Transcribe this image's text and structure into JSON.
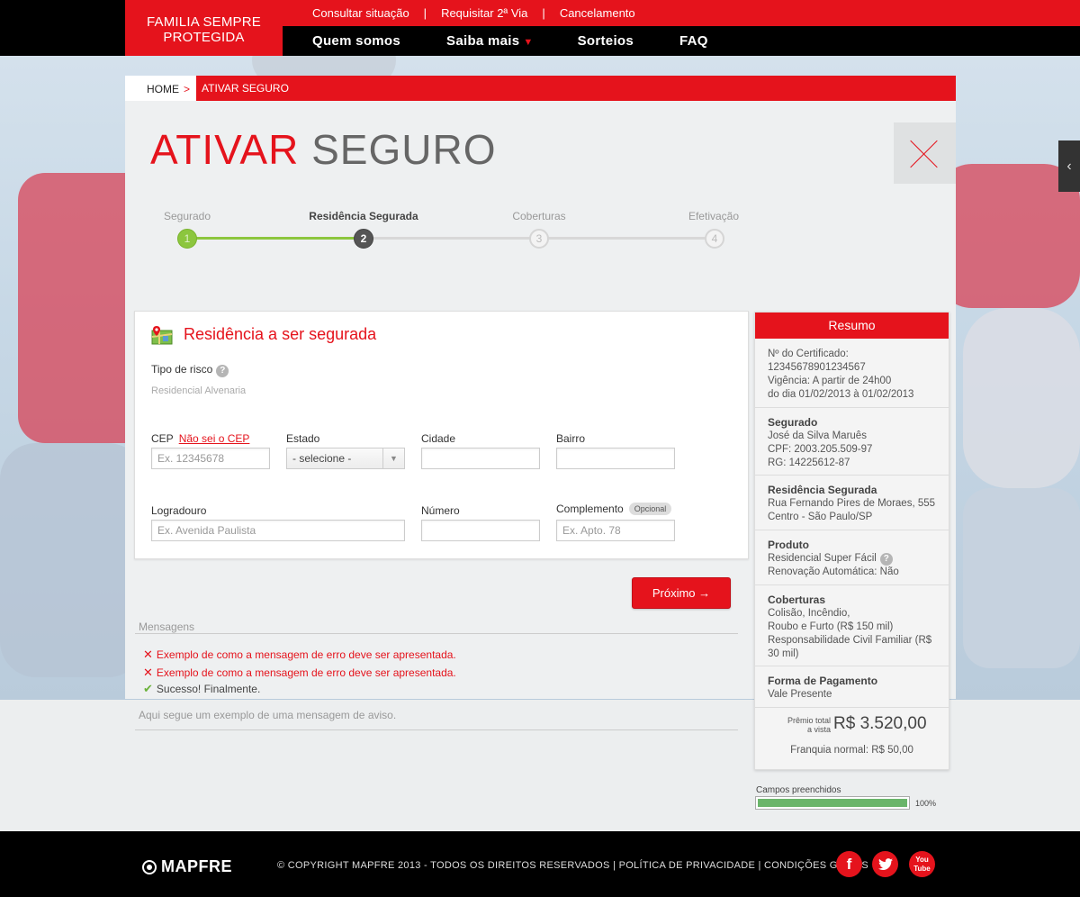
{
  "header": {
    "brand": "FAMILIA SEMPRE PROTEGIDA",
    "top_links": [
      "Consultar situação",
      "Requisitar 2ª Via",
      "Cancelamento"
    ],
    "separator": "|",
    "nav": [
      "Quem somos",
      "Saiba mais",
      "Sorteios",
      "FAQ"
    ],
    "nav_dropdown_icon": "chevron-down-icon"
  },
  "breadcrumb": {
    "home": "HOME",
    "arrow": ">",
    "current": "ATIVAR SEGURO"
  },
  "page_title": {
    "part1": "ATIVAR",
    "part2": "SEGURO"
  },
  "close_icon": "close-icon",
  "side_tab_icon": "chevron-left-icon",
  "side_tab_glyph": "‹",
  "stepper": {
    "steps": [
      {
        "label": "Segurado",
        "number": "1",
        "state": "done"
      },
      {
        "label": "Residência Segurada",
        "number": "2",
        "state": "current"
      },
      {
        "label": "Coberturas",
        "number": "3",
        "state": "todo"
      },
      {
        "label": "Efetivação",
        "number": "4",
        "state": "todo"
      }
    ],
    "done_color": "#8cc63e"
  },
  "form": {
    "title": "Residência a ser segurada",
    "title_icon": "map-icon",
    "tipo_risco_label": "Tipo de risco",
    "help_glyph": "?",
    "tipo_risco_value": "Residencial Alvenaria",
    "cep_label": "CEP",
    "cep_link": "Não sei o CEP",
    "cep_placeholder": "Ex. 12345678",
    "estado_label": "Estado",
    "estado_selected": "- selecione -",
    "cidade_label": "Cidade",
    "bairro_label": "Bairro",
    "logradouro_label": "Logradouro",
    "logradouro_placeholder": "Ex. Avenida Paulista",
    "numero_label": "Número",
    "complemento_label": "Complemento",
    "complemento_badge": "Opcional",
    "complemento_placeholder": "Ex. Apto. 78"
  },
  "next_button": "Próximo →",
  "messages": {
    "title": "Mensagens",
    "items": [
      {
        "type": "error",
        "icon": "✕",
        "text": "Exemplo de como a mensagem de erro deve ser apresentada."
      },
      {
        "type": "error",
        "icon": "✕",
        "text": "Exemplo de como a mensagem de erro deve ser apresentada."
      },
      {
        "type": "success",
        "icon": "✔",
        "text": "Sucesso! Finalmente."
      }
    ],
    "warning": "Aqui segue um exemplo de uma mensagem de aviso."
  },
  "summary": {
    "title": "Resumo",
    "certificate": {
      "line1": "Nº do Certificado:",
      "line2": "12345678901234567",
      "line3": "Vigência: A partir de 24h00",
      "line4": "do dia 01/02/2013 à 01/02/2013"
    },
    "segurado": {
      "title": "Segurado",
      "name": "José da Silva Maruês",
      "cpf": "CPF: 2003.205.509-97",
      "rg": "RG: 14225612-87"
    },
    "residencia": {
      "title": "Residência Segurada",
      "line1": "Rua Fernando Pires de Moraes, 555",
      "line2": "Centro - São Paulo/SP"
    },
    "produto": {
      "title": "Produto",
      "line1": "Residencial Super Fácil",
      "line2": "Renovação Automática: Não"
    },
    "coberturas": {
      "title": "Coberturas",
      "line1": "Colisão, Incêndio,",
      "line2": "Roubo e Furto (R$ 150 mil)",
      "line3": "Responsabilidade Civil Familiar (R$ 30 mil)"
    },
    "pagamento": {
      "title": "Forma de Pagamento",
      "line1": "Vale Presente"
    },
    "premio_label_1": "Prêmio total",
    "premio_label_2": "a vista",
    "premio_value": "R$ 3.520,00",
    "franquia": "Franquia normal: R$ 50,00"
  },
  "progress": {
    "label": "Campos preenchidos",
    "value_text": "100%",
    "fraction": 1.0,
    "fill_color": "#6ab56a"
  },
  "footer": {
    "logo": "MAPFRE",
    "copyright": "© COPYRIGHT MAPFRE 2013 - TODOS OS DIREITOS RESERVADOS",
    "privacy": "POLÍTICA DE PRIVACIDADE",
    "conditions": "CONDIÇÕES GERAIS",
    "sep": "|",
    "social": {
      "facebook": "f",
      "twitter": "t",
      "youtube_1": "You",
      "youtube_2": "Tube"
    }
  },
  "colors": {
    "brand_red": "#e5131c",
    "black": "#000000"
  }
}
